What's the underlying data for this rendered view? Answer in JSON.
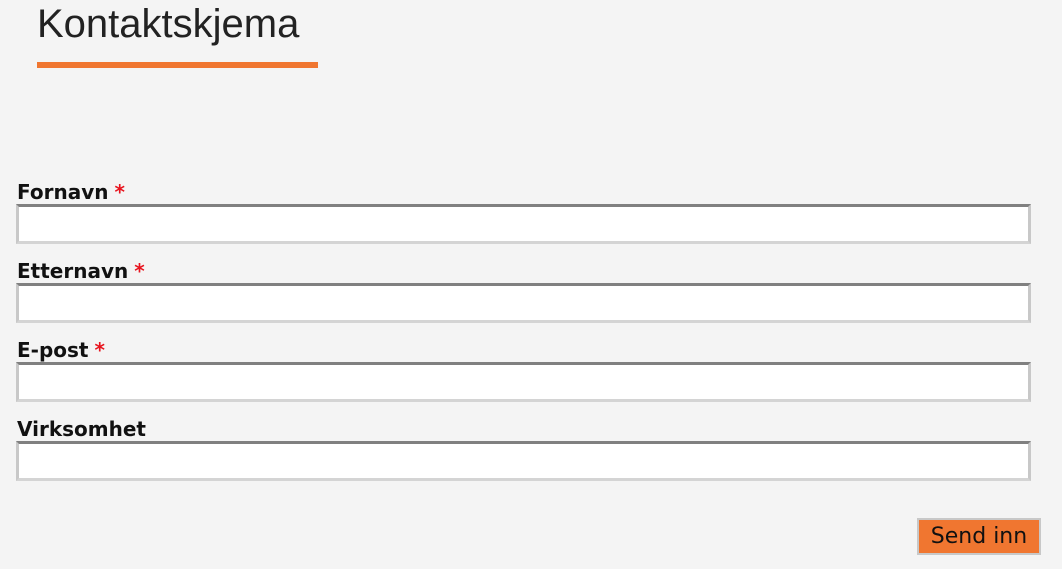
{
  "page": {
    "title": "Kontaktskjema",
    "accent_color": "#f07630",
    "required_color": "#e8141e",
    "background_color": "#f4f4f4"
  },
  "form": {
    "fields": [
      {
        "label": "Fornavn",
        "required_marker": "*",
        "value": ""
      },
      {
        "label": "Etternavn",
        "required_marker": "*",
        "value": ""
      },
      {
        "label": "E-post",
        "required_marker": "*",
        "value": ""
      },
      {
        "label": "Virksomhet",
        "required_marker": "",
        "value": ""
      }
    ],
    "submit_label": "Send inn"
  }
}
